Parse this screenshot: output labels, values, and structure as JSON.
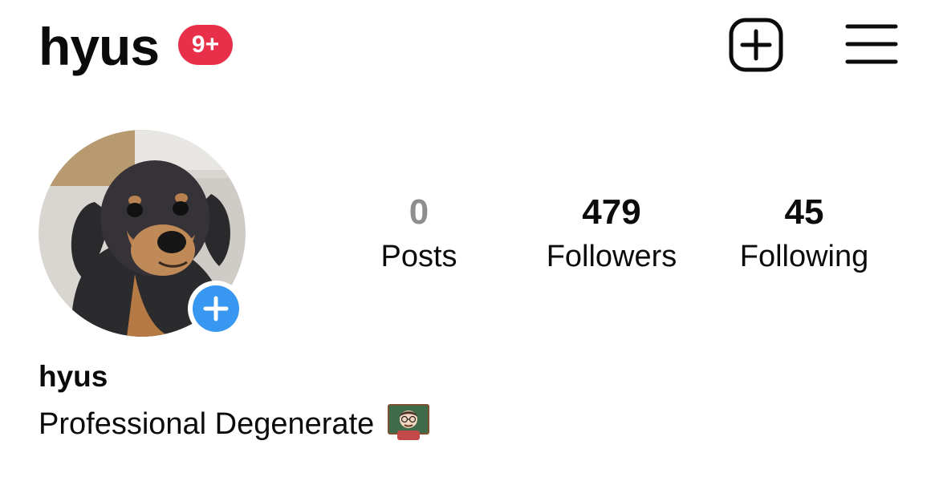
{
  "header": {
    "username": "hyus",
    "notification_badge": "9+",
    "new_post_icon": "plus-square-icon",
    "menu_icon": "hamburger-menu-icon"
  },
  "profile": {
    "avatar_description": "profile-photo-dachshund",
    "add_story_icon": "plus-icon",
    "stats": {
      "posts": {
        "value": "0",
        "label": "Posts"
      },
      "followers": {
        "value": "479",
        "label": "Followers"
      },
      "following": {
        "value": "45",
        "label": "Following"
      }
    },
    "display_name": "hyus",
    "bio_text": "Professional Degenerate",
    "bio_emoji": "teacher-emoji"
  },
  "colors": {
    "badge": "#e8304a",
    "add_story": "#3897f0",
    "muted_count": "#8e8e8e",
    "text": "#0b0b0b"
  }
}
